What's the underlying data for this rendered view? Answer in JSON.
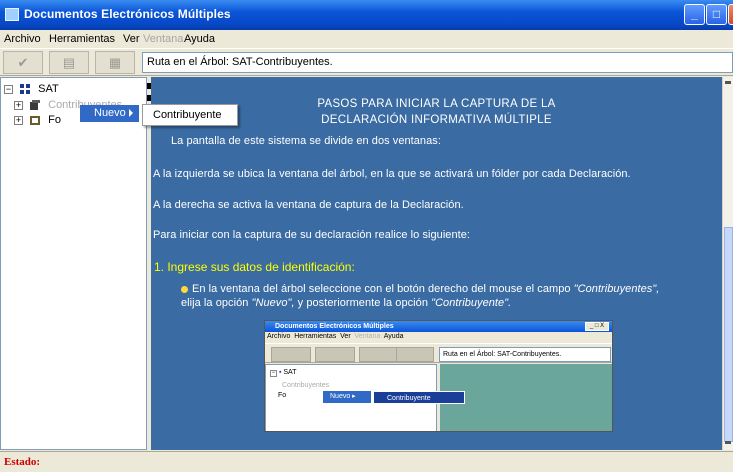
{
  "window": {
    "title": "Documentos Electrónicos Múltiples",
    "minimize": "_",
    "maximize": "□",
    "close": "X"
  },
  "menu": {
    "archivo": "Archivo",
    "herramientas": "Herramientas",
    "ver": "Ver",
    "ventana": "Ventana",
    "ayuda": "Ayuda"
  },
  "toolbar": {
    "path_text": "Ruta en el Árbol: SAT-Contribuyentes."
  },
  "tree": {
    "root_label": "SAT",
    "item1_label": "Contribuyentes",
    "item2_label": "Fo"
  },
  "context_menu": {
    "nuevo_label": "Nuevo",
    "contribuyente_label": "Contribuyente"
  },
  "content": {
    "heading_line1": "PASOS PARA INICIAR LA CAPTURA DE LA",
    "heading_line2": "DECLARACIÓN INFORMATIVA MÚLTIPLE",
    "para1": "La pantalla de este sistema se divide en dos ventanas:",
    "para2": "A la izquierda se ubica la ventana del árbol, en la que se activará un fólder por cada Declaración.",
    "para3": "A la derecha se activa la ventana de captura de la Declaración.",
    "para4": "Para iniciar con la captura de su declaración realice lo siguiente:",
    "section1": "1. Ingrese sus datos de identificación:",
    "step_line1_a": "En la ventana del árbol seleccione con el botón derecho del mouse el campo ",
    "step_line1_b": "\"Contribuyentes\",",
    "step_line2_a": "elija la opción ",
    "step_line2_b": "\"Nuevo\",",
    "step_line2_c": " y posteriormente la opción ",
    "step_line2_d": "\"Contribuyente\"."
  },
  "screenshot": {
    "title": "Documentos Electrónicos Múltiples",
    "menu_archivo": "Archivo",
    "menu_herramientas": "Herramientas",
    "menu_ver": "Ver",
    "menu_ventana": "Ventana",
    "menu_ayuda": "Ayuda",
    "path_text": "Ruta en el Árbol: SAT-Contribuyentes.",
    "tree_root": "SAT",
    "tree_item1": "Contribuyentes",
    "tree_item2": "Fo",
    "nuevo": "Nuevo",
    "contribuyente": "Contribuyente",
    "window_buttons": "_ □ X"
  },
  "status": {
    "label": "Estado:"
  },
  "colors": {
    "content_bg": "#3a6ba3",
    "section_heading": "#ffff00",
    "status_label": "#cc0000",
    "menu_highlight": "#3169c6"
  }
}
